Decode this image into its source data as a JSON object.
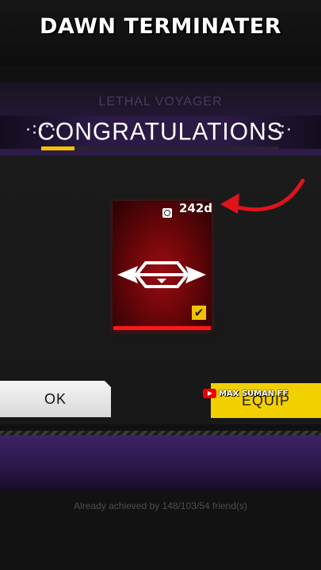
{
  "video": {
    "title": "DAWN TERMINATER"
  },
  "background": {
    "faded_heading": "LETHAL VOYAGER"
  },
  "dialog": {
    "title": "CONGRATULATIONS",
    "progress_fraction": 0.14,
    "item": {
      "duration": "242d",
      "equipped_checked": true
    },
    "ok_label": "OK",
    "equip_label": "EQUIP",
    "footer_note": "Already achieved by 148/103/54 friend(s)"
  },
  "watermark": {
    "channel": "MAX SUMAN FF",
    "icon": "youtube-icon"
  },
  "colors": {
    "accent_yellow": "#f2c200",
    "card_red": "#9a0c12",
    "arrow_red": "#e0121b",
    "banner_purple": "#2b1a45"
  }
}
